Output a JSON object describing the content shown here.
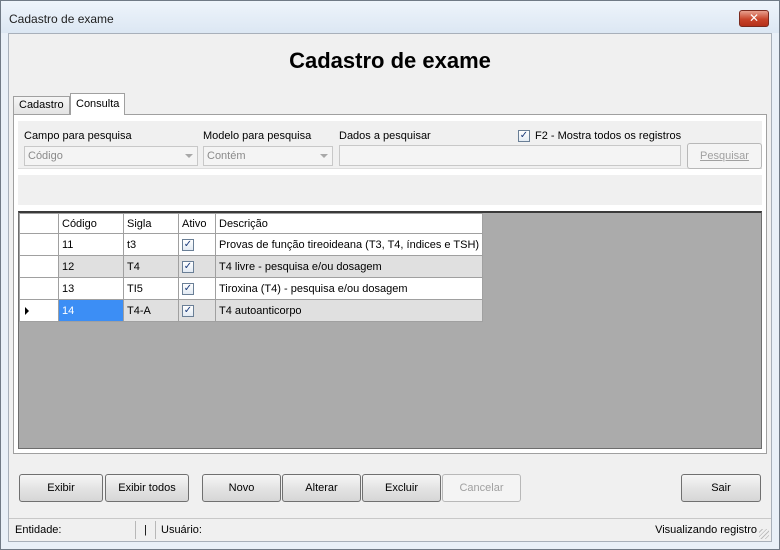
{
  "window": {
    "title": "Cadastro de exame",
    "close_glyph": "✕"
  },
  "form": {
    "title": "Cadastro de exame"
  },
  "tabs": [
    {
      "label": "Cadastro",
      "active": false
    },
    {
      "label": "Consulta",
      "active": true
    }
  ],
  "search": {
    "field_label": "Campo para pesquisa",
    "field_value": "Código",
    "model_label": "Modelo para pesquisa",
    "model_value": "Contém",
    "data_label": "Dados a pesquisar",
    "data_value": "",
    "show_all_label": "F2 - Mostra todos os registros",
    "show_all_checked": true,
    "search_button": "Pesquisar"
  },
  "grid": {
    "columns": [
      "Código",
      "Sigla",
      "Ativo",
      "Descrição"
    ],
    "rows": [
      {
        "codigo": "11",
        "sigla": "t3",
        "ativo": true,
        "descricao": "Provas de função tireoideana (T3, T4, índices e TSH)"
      },
      {
        "codigo": "12",
        "sigla": "T4",
        "ativo": true,
        "descricao": "T4 livre - pesquisa e/ou dosagem"
      },
      {
        "codigo": "13",
        "sigla": "TI5",
        "ativo": true,
        "descricao": "Tiroxina (T4) - pesquisa e/ou dosagem"
      },
      {
        "codigo": "14",
        "sigla": "T4-A",
        "ativo": true,
        "descricao": "T4 autoanticorpo"
      }
    ],
    "check_glyph": "✓",
    "selected_row": 3
  },
  "buttons": {
    "exibir": "Exibir",
    "exibir_todos": "Exibir todos",
    "novo": "Novo",
    "alterar": "Alterar",
    "excluir": "Excluir",
    "cancelar": "Cancelar",
    "sair": "Sair"
  },
  "status": {
    "entidade_label": "Entidade:",
    "separator": "|",
    "usuario_label": "Usuário:",
    "mode": "Visualizando registro"
  },
  "colors": {
    "selection": "#3c8ef5",
    "alt_row": "#e0e0e0",
    "close_button": "#c8442a"
  }
}
